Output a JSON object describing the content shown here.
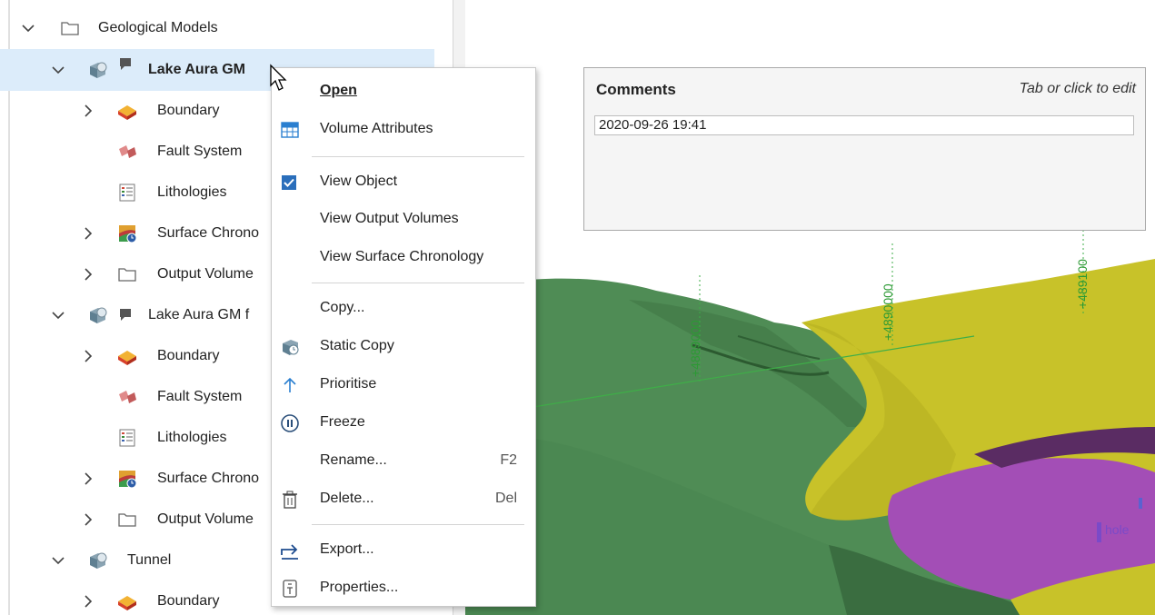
{
  "tree": {
    "items": [
      {
        "label": "Geological Models",
        "icon": "folder-icon"
      },
      {
        "label": "Lake Aura GM",
        "icon": "geological-model-icon"
      },
      {
        "label": "Boundary",
        "icon": "boundary-icon"
      },
      {
        "label": "Fault System",
        "icon": "fault-system-icon"
      },
      {
        "label": "Lithologies",
        "icon": "lithologies-icon"
      },
      {
        "label": "Surface Chrono",
        "icon": "surface-chronology-icon"
      },
      {
        "label": "Output Volume",
        "icon": "folder-icon"
      },
      {
        "label": "Lake Aura GM f",
        "icon": "geological-model-icon"
      },
      {
        "label": "Boundary",
        "icon": "boundary-icon"
      },
      {
        "label": "Fault System",
        "icon": "fault-system-icon"
      },
      {
        "label": "Lithologies",
        "icon": "lithologies-icon"
      },
      {
        "label": "Surface Chrono",
        "icon": "surface-chronology-icon"
      },
      {
        "label": "Output Volume",
        "icon": "folder-icon"
      },
      {
        "label": "Tunnel",
        "icon": "geological-model-icon"
      },
      {
        "label": "Boundary",
        "icon": "boundary-icon"
      }
    ]
  },
  "menu": {
    "open": "Open",
    "volume_attributes": "Volume Attributes",
    "view_object": "View Object",
    "view_output_volumes": "View Output Volumes",
    "view_surface_chronology": "View Surface Chronology",
    "copy": "Copy...",
    "static_copy": "Static Copy",
    "prioritise": "Prioritise",
    "freeze": "Freeze",
    "rename": "Rename...",
    "rename_shortcut": "F2",
    "delete": "Delete...",
    "delete_shortcut": "Del",
    "export": "Export...",
    "properties": "Properties..."
  },
  "comments": {
    "title": "Comments",
    "hint": "Tab or click to edit",
    "value": "2020-09-26 19:41"
  },
  "scene": {
    "grid_labels": [
      "+4889000",
      "+4890000",
      "+489100"
    ],
    "annotation": "hole"
  },
  "colors": {
    "selection": "#dcecfa",
    "checkbox": "#2a6ebb",
    "surface_green": "#4e8a52",
    "surface_yellow": "#c9c42a",
    "surface_purple": "#a24db8"
  }
}
